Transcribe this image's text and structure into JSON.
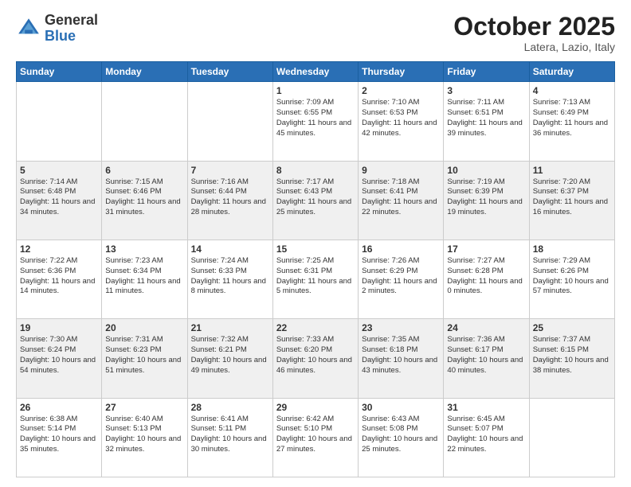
{
  "header": {
    "logo_general": "General",
    "logo_blue": "Blue",
    "month": "October 2025",
    "location": "Latera, Lazio, Italy"
  },
  "days_of_week": [
    "Sunday",
    "Monday",
    "Tuesday",
    "Wednesday",
    "Thursday",
    "Friday",
    "Saturday"
  ],
  "weeks": [
    [
      {
        "day": "",
        "info": ""
      },
      {
        "day": "",
        "info": ""
      },
      {
        "day": "",
        "info": ""
      },
      {
        "day": "1",
        "info": "Sunrise: 7:09 AM\nSunset: 6:55 PM\nDaylight: 11 hours\nand 45 minutes."
      },
      {
        "day": "2",
        "info": "Sunrise: 7:10 AM\nSunset: 6:53 PM\nDaylight: 11 hours\nand 42 minutes."
      },
      {
        "day": "3",
        "info": "Sunrise: 7:11 AM\nSunset: 6:51 PM\nDaylight: 11 hours\nand 39 minutes."
      },
      {
        "day": "4",
        "info": "Sunrise: 7:13 AM\nSunset: 6:49 PM\nDaylight: 11 hours\nand 36 minutes."
      }
    ],
    [
      {
        "day": "5",
        "info": "Sunrise: 7:14 AM\nSunset: 6:48 PM\nDaylight: 11 hours\nand 34 minutes."
      },
      {
        "day": "6",
        "info": "Sunrise: 7:15 AM\nSunset: 6:46 PM\nDaylight: 11 hours\nand 31 minutes."
      },
      {
        "day": "7",
        "info": "Sunrise: 7:16 AM\nSunset: 6:44 PM\nDaylight: 11 hours\nand 28 minutes."
      },
      {
        "day": "8",
        "info": "Sunrise: 7:17 AM\nSunset: 6:43 PM\nDaylight: 11 hours\nand 25 minutes."
      },
      {
        "day": "9",
        "info": "Sunrise: 7:18 AM\nSunset: 6:41 PM\nDaylight: 11 hours\nand 22 minutes."
      },
      {
        "day": "10",
        "info": "Sunrise: 7:19 AM\nSunset: 6:39 PM\nDaylight: 11 hours\nand 19 minutes."
      },
      {
        "day": "11",
        "info": "Sunrise: 7:20 AM\nSunset: 6:37 PM\nDaylight: 11 hours\nand 16 minutes."
      }
    ],
    [
      {
        "day": "12",
        "info": "Sunrise: 7:22 AM\nSunset: 6:36 PM\nDaylight: 11 hours\nand 14 minutes."
      },
      {
        "day": "13",
        "info": "Sunrise: 7:23 AM\nSunset: 6:34 PM\nDaylight: 11 hours\nand 11 minutes."
      },
      {
        "day": "14",
        "info": "Sunrise: 7:24 AM\nSunset: 6:33 PM\nDaylight: 11 hours\nand 8 minutes."
      },
      {
        "day": "15",
        "info": "Sunrise: 7:25 AM\nSunset: 6:31 PM\nDaylight: 11 hours\nand 5 minutes."
      },
      {
        "day": "16",
        "info": "Sunrise: 7:26 AM\nSunset: 6:29 PM\nDaylight: 11 hours\nand 2 minutes."
      },
      {
        "day": "17",
        "info": "Sunrise: 7:27 AM\nSunset: 6:28 PM\nDaylight: 11 hours\nand 0 minutes."
      },
      {
        "day": "18",
        "info": "Sunrise: 7:29 AM\nSunset: 6:26 PM\nDaylight: 10 hours\nand 57 minutes."
      }
    ],
    [
      {
        "day": "19",
        "info": "Sunrise: 7:30 AM\nSunset: 6:24 PM\nDaylight: 10 hours\nand 54 minutes."
      },
      {
        "day": "20",
        "info": "Sunrise: 7:31 AM\nSunset: 6:23 PM\nDaylight: 10 hours\nand 51 minutes."
      },
      {
        "day": "21",
        "info": "Sunrise: 7:32 AM\nSunset: 6:21 PM\nDaylight: 10 hours\nand 49 minutes."
      },
      {
        "day": "22",
        "info": "Sunrise: 7:33 AM\nSunset: 6:20 PM\nDaylight: 10 hours\nand 46 minutes."
      },
      {
        "day": "23",
        "info": "Sunrise: 7:35 AM\nSunset: 6:18 PM\nDaylight: 10 hours\nand 43 minutes."
      },
      {
        "day": "24",
        "info": "Sunrise: 7:36 AM\nSunset: 6:17 PM\nDaylight: 10 hours\nand 40 minutes."
      },
      {
        "day": "25",
        "info": "Sunrise: 7:37 AM\nSunset: 6:15 PM\nDaylight: 10 hours\nand 38 minutes."
      }
    ],
    [
      {
        "day": "26",
        "info": "Sunrise: 6:38 AM\nSunset: 5:14 PM\nDaylight: 10 hours\nand 35 minutes."
      },
      {
        "day": "27",
        "info": "Sunrise: 6:40 AM\nSunset: 5:13 PM\nDaylight: 10 hours\nand 32 minutes."
      },
      {
        "day": "28",
        "info": "Sunrise: 6:41 AM\nSunset: 5:11 PM\nDaylight: 10 hours\nand 30 minutes."
      },
      {
        "day": "29",
        "info": "Sunrise: 6:42 AM\nSunset: 5:10 PM\nDaylight: 10 hours\nand 27 minutes."
      },
      {
        "day": "30",
        "info": "Sunrise: 6:43 AM\nSunset: 5:08 PM\nDaylight: 10 hours\nand 25 minutes."
      },
      {
        "day": "31",
        "info": "Sunrise: 6:45 AM\nSunset: 5:07 PM\nDaylight: 10 hours\nand 22 minutes."
      },
      {
        "day": "",
        "info": ""
      }
    ]
  ]
}
